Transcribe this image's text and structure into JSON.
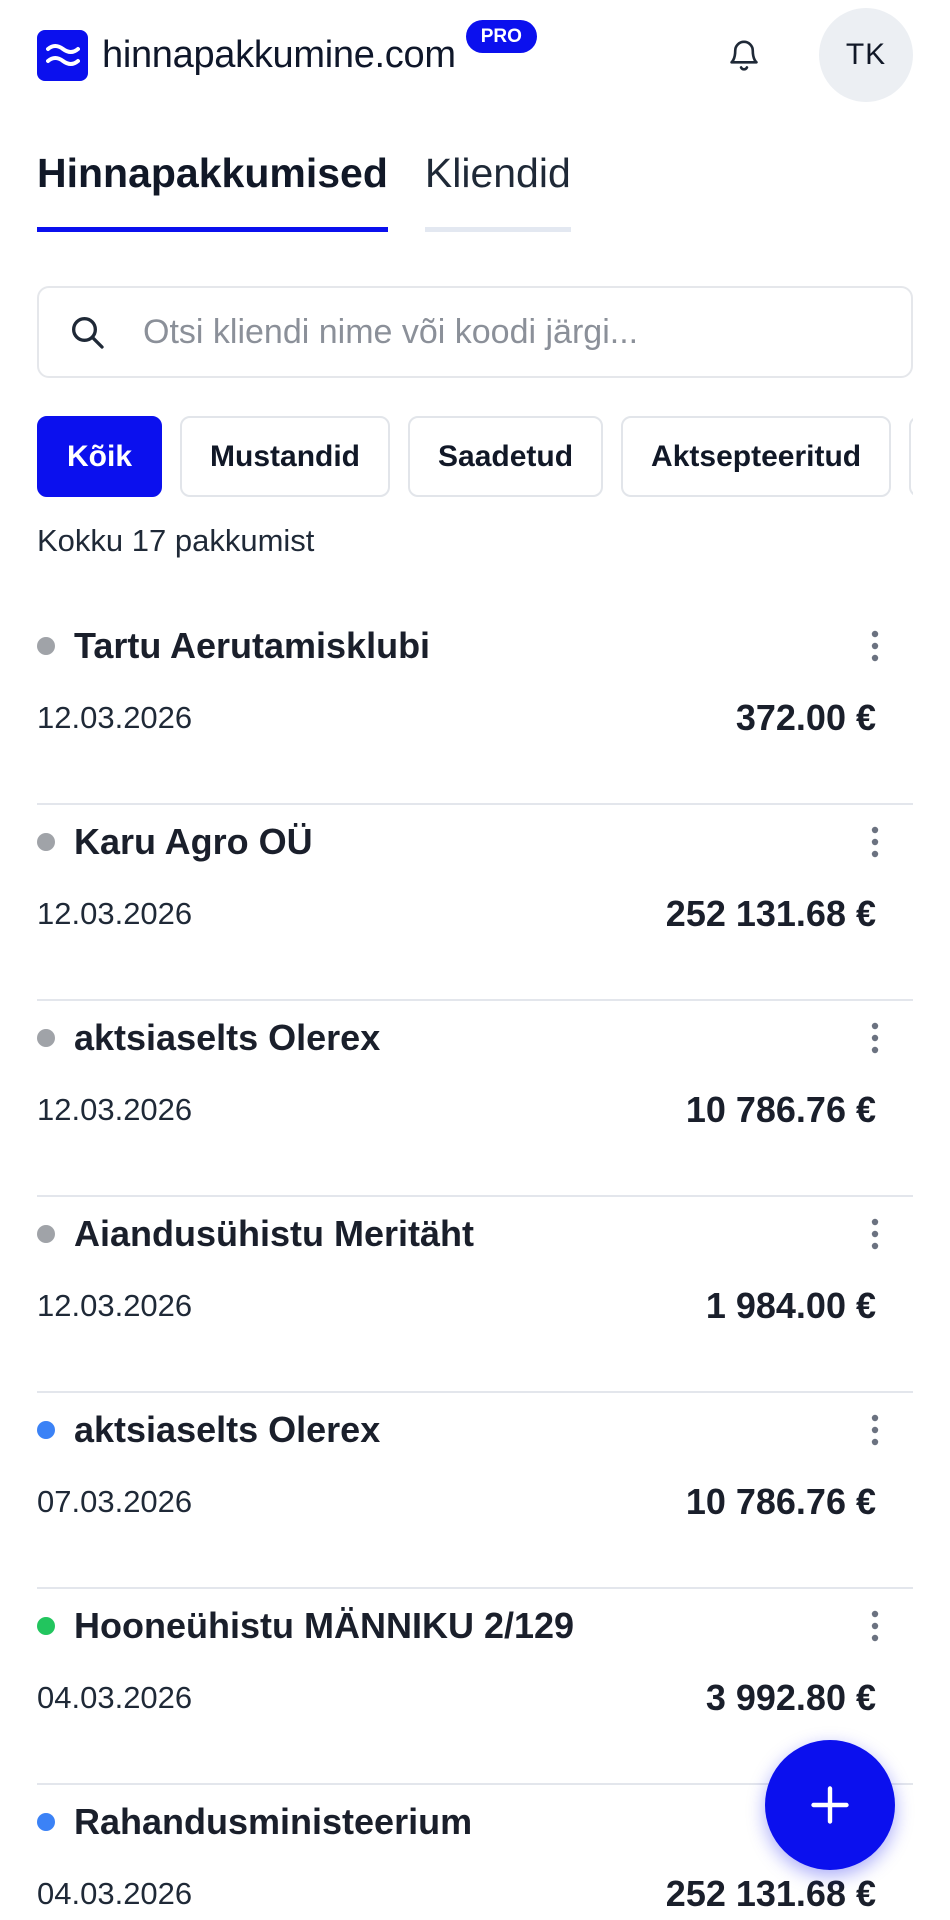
{
  "header": {
    "brand_name": "hinnapakkumine.com",
    "pro_badge": "PRO",
    "avatar_initials": "TK",
    "brand_color": "#0b10ee"
  },
  "tabs": [
    {
      "label": "Hinnapakkumised",
      "active": true
    },
    {
      "label": "Kliendid",
      "active": false
    }
  ],
  "search": {
    "placeholder": "Otsi kliendi nime või koodi järgi...",
    "value": ""
  },
  "filters": [
    {
      "label": "Kõik",
      "active": true
    },
    {
      "label": "Mustandid",
      "active": false
    },
    {
      "label": "Saadetud",
      "active": false
    },
    {
      "label": "Aktsepteeritud",
      "active": false
    }
  ],
  "summary": "Kokku 17 pakkumist",
  "status_colors": {
    "draft": "#a0a3a8",
    "sent": "#3b82f6",
    "accepted": "#22c55e"
  },
  "offers": [
    {
      "client": "Tartu Aerutamisklubi",
      "date": "12.03.2026",
      "amount": "372.00 €",
      "status": "draft"
    },
    {
      "client": "Karu Agro OÜ",
      "date": "12.03.2026",
      "amount": "252 131.68 €",
      "status": "draft"
    },
    {
      "client": "aktsiaselts Olerex",
      "date": "12.03.2026",
      "amount": "10 786.76 €",
      "status": "draft"
    },
    {
      "client": "Aiandusühistu Meritäht",
      "date": "12.03.2026",
      "amount": "1 984.00 €",
      "status": "draft"
    },
    {
      "client": "aktsiaselts Olerex",
      "date": "07.03.2026",
      "amount": "10 786.76 €",
      "status": "sent"
    },
    {
      "client": "Hooneühistu MÄNNIKU 2/129",
      "date": "04.03.2026",
      "amount": "3 992.80 €",
      "status": "accepted"
    },
    {
      "client": "Rahandusministeerium",
      "date": "04.03.2026",
      "amount": "252 131.68 €",
      "status": "sent"
    }
  ],
  "icons": {
    "logo": "waves-icon",
    "notifications": "bell-icon",
    "search": "search-icon",
    "row_menu": "more-vertical-icon",
    "fab": "plus-icon"
  }
}
